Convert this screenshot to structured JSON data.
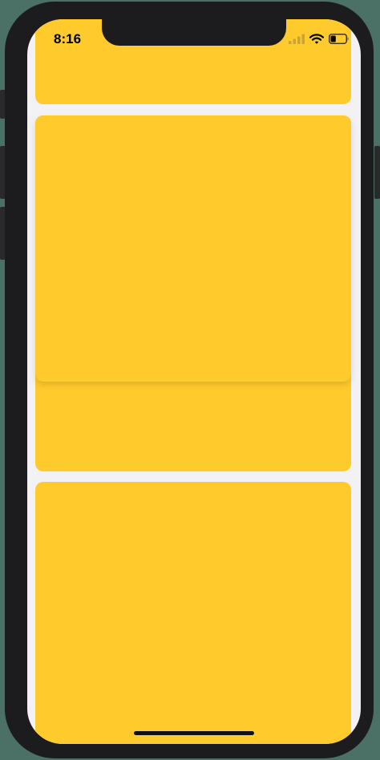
{
  "status_bar": {
    "time": "8:16",
    "signal_icon": "cellular-signal-icon",
    "wifi_icon": "wifi-icon",
    "battery_icon": "battery-icon",
    "battery_level": 0.35
  },
  "colors": {
    "card": "#ffca2c",
    "background": "#f2f2f4",
    "device": "#1c1c1e"
  },
  "cards": {
    "count": 4
  }
}
